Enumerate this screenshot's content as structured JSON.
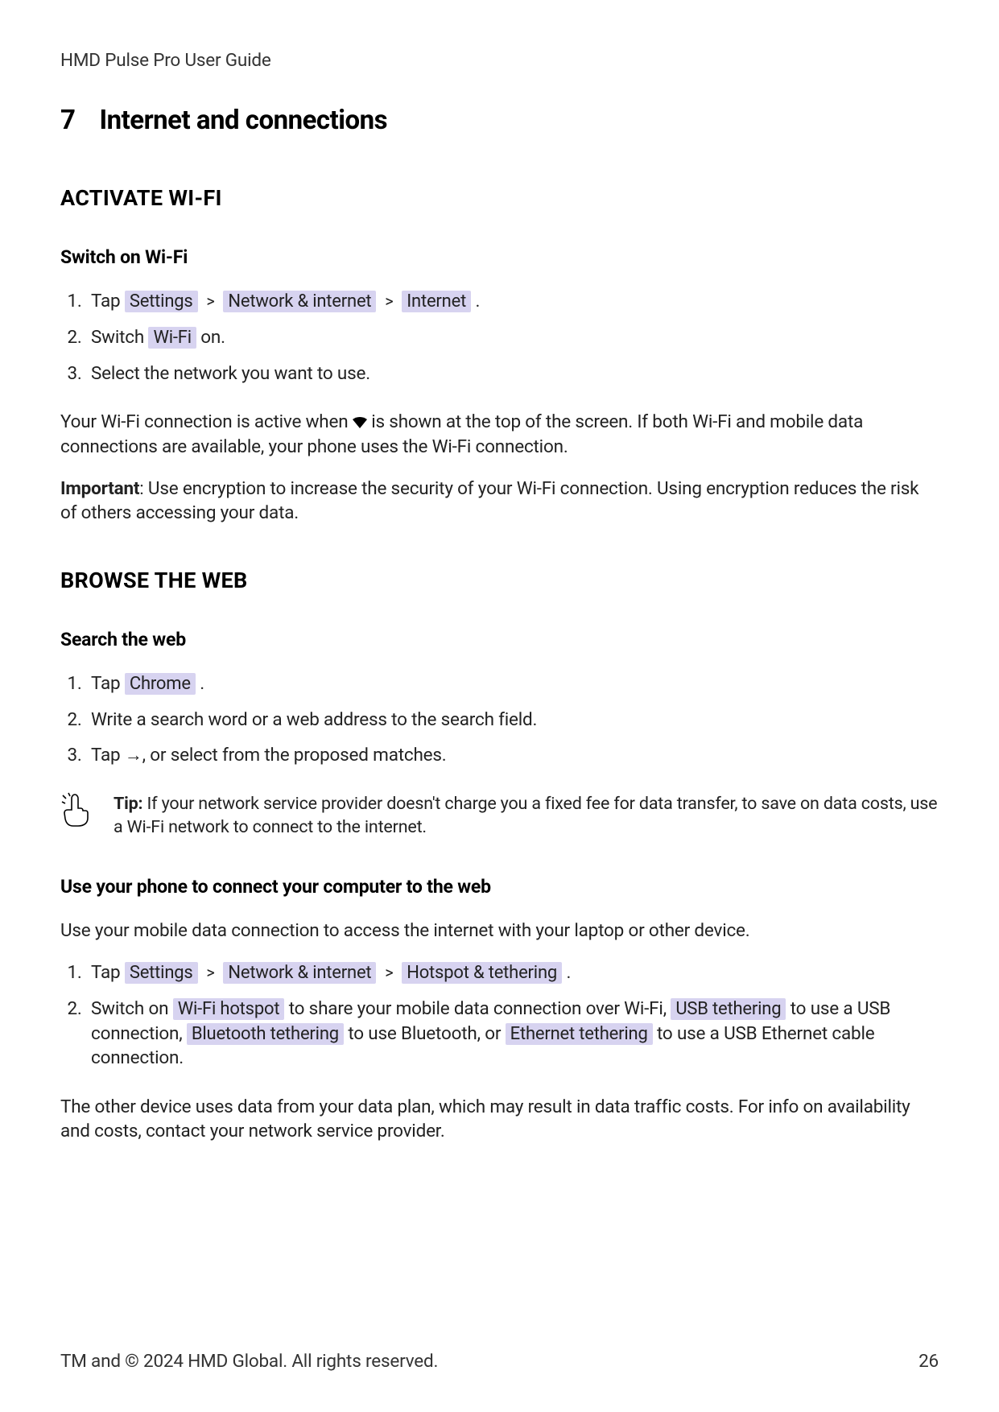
{
  "header": {
    "title": "HMD Pulse Pro User Guide"
  },
  "chapter": {
    "number": "7",
    "title": "Internet and connections"
  },
  "sections": {
    "wifi": {
      "heading": "ACTIVATE WI-FI",
      "sub1": {
        "heading": "Switch on Wi-Fi",
        "steps": {
          "s1_prefix": "Tap ",
          "s1_lbl1": "Settings",
          "s1_sep": " > ",
          "s1_lbl2": "Network & internet",
          "s1_lbl3": "Internet",
          "s1_suffix": " .",
          "s2_prefix": "Switch ",
          "s2_lbl": "Wi-Fi",
          "s2_suffix": " on.",
          "s3": "Select the network you want to use."
        },
        "after1_prefix": "Your Wi-Fi connection is active when ",
        "after1_suffix": " is shown at the top of the screen. If both Wi-Fi and mobile data connections are available, your phone uses the Wi-Fi connection.",
        "important_label": "Important",
        "important_text": ": Use encryption to increase the security of your Wi-Fi connection. Using encryption reduces the risk of others accessing your data."
      }
    },
    "browse": {
      "heading": "BROWSE THE WEB",
      "sub1": {
        "heading": "Search the web",
        "steps": {
          "s1_prefix": "Tap ",
          "s1_lbl": "Chrome",
          "s1_suffix": " .",
          "s2": "Write a search word or a web address to the search field.",
          "s3_prefix": "Tap ",
          "s3_suffix": ", or select from the proposed matches."
        }
      },
      "tip": {
        "label": "Tip:",
        "text": " If your network service provider doesn't charge you a fixed fee for data transfer, to save on data costs, use a Wi-Fi network to connect to the internet."
      },
      "sub2": {
        "heading": "Use your phone to connect your computer to the web",
        "intro": "Use your mobile data connection to access the internet with your laptop or other device.",
        "steps": {
          "s1_prefix": "Tap ",
          "s1_lbl1": "Settings",
          "s1_sep": " > ",
          "s1_lbl2": "Network & internet",
          "s1_lbl3": "Hotspot & tethering",
          "s1_suffix": " .",
          "s2_a": "Switch on ",
          "s2_lbl1": "Wi-Fi hotspot",
          "s2_b": " to share your mobile data connection over Wi-Fi, ",
          "s2_lbl2": "USB tethering",
          "s2_c": " to use a USB connection, ",
          "s2_lbl3": "Bluetooth tethering",
          "s2_d": " to use Bluetooth, or ",
          "s2_lbl4": "Ethernet tethering",
          "s2_e": " to use a USB Ethernet cable connection."
        },
        "after": "The other device uses data from your data plan, which may result in data traffic costs. For info on availability and costs, contact your network service provider."
      }
    }
  },
  "footer": {
    "copyright": "TM and © 2024 HMD Global. All rights reserved.",
    "page": "26"
  }
}
